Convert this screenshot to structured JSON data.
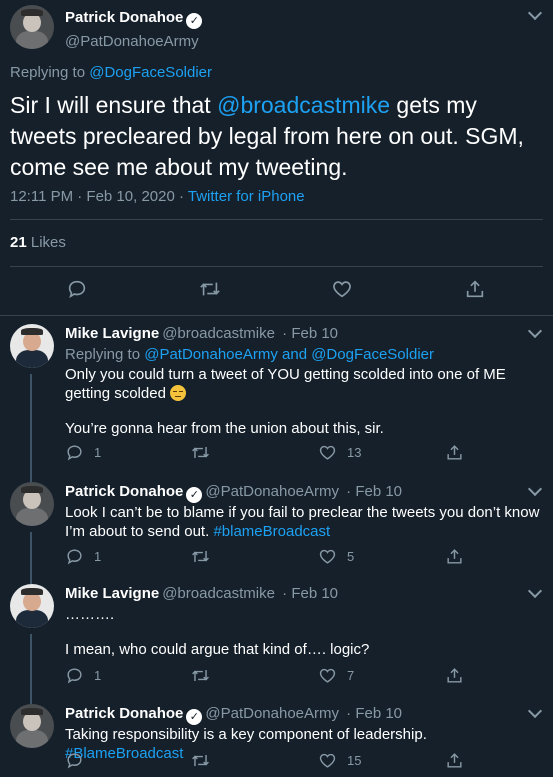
{
  "main_tweet": {
    "author_name": "Patrick Donahoe",
    "author_handle": "@PatDonahoeArmy",
    "replying_prefix": "Replying to ",
    "replying_to": "@DogFaceSoldier",
    "text_part1": "Sir I will ensure that ",
    "mention": "@broadcastmike",
    "text_part2": " gets my tweets precleared by legal from here on out. SGM, come see me about my tweeting.",
    "timestamp": "12:11 PM · Feb 10, 2020",
    "separator": " · ",
    "source": "Twitter for iPhone",
    "likes_count": "21",
    "likes_label": " Likes"
  },
  "replies": [
    {
      "author_name": "Mike Lavigne",
      "author_handle": "@broadcastmike",
      "date": " · Feb 10",
      "replying_prefix": "Replying to ",
      "replying_to": "@PatDonahoeArmy and @DogFaceSoldier",
      "text_line1": "Only you could turn a tweet of YOU getting scolded into one of ME getting scolded",
      "text_line2": "You’re gonna hear from the union about this, sir.",
      "reply_count": "1",
      "retweet_count": "",
      "like_count": "13"
    },
    {
      "author_name": "Patrick Donahoe",
      "author_handle": "@PatDonahoeArmy",
      "date": " · Feb 10",
      "text_line1": "Look I can’t be to blame if you fail to preclear the tweets you don’t know I’m about to send out. ",
      "hashtag": "#blameBroadcast",
      "reply_count": "1",
      "retweet_count": "",
      "like_count": "5"
    },
    {
      "author_name": "Mike Lavigne",
      "author_handle": "@broadcastmike",
      "date": " · Feb 10",
      "text_line1": "……….",
      "text_line2": "I mean, who could argue that kind of…. logic?",
      "reply_count": "1",
      "retweet_count": "",
      "like_count": "7"
    },
    {
      "author_name": "Patrick Donahoe",
      "author_handle": "@PatDonahoeArmy",
      "date": " · Feb 10",
      "text_line1": "Taking responsibility is a key component of leadership. ",
      "hashtag": "#BlameBroadcast",
      "reply_count": "",
      "retweet_count": "",
      "like_count": "15"
    }
  ],
  "colors": {
    "background": "#15202b",
    "accent": "#1da1f2",
    "muted": "#8899a6",
    "divider": "#38444d"
  },
  "icons": [
    "reply-icon",
    "retweet-icon",
    "like-icon",
    "share-icon",
    "verified-badge-icon",
    "chevron-down-icon"
  ]
}
